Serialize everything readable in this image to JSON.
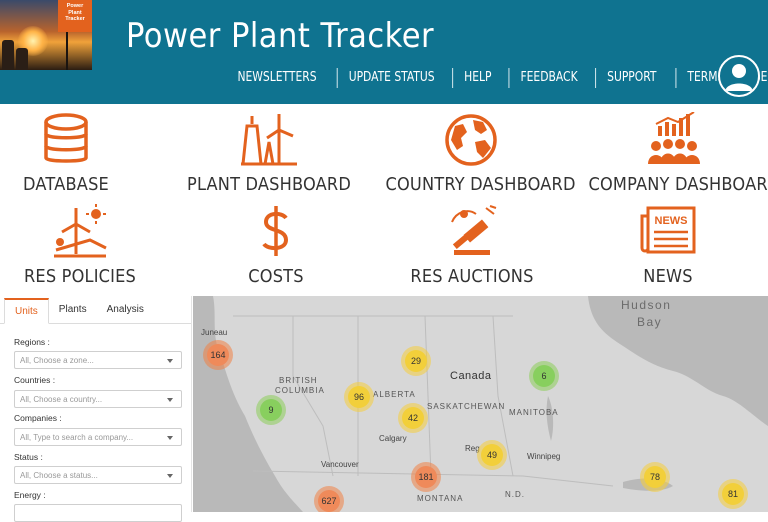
{
  "header": {
    "title": "Power Plant Tracker",
    "logo_text": [
      "Power",
      "Plant",
      "Tracker"
    ],
    "nav": [
      "NEWSLETTERS",
      "UPDATE STATUS",
      "HELP",
      "FEEDBACK",
      "SUPPORT",
      "TERMS OF USE"
    ],
    "avatar_icon": "user-icon"
  },
  "tiles": [
    {
      "label": "DATABASE",
      "icon": "database-icon"
    },
    {
      "label": "PLANT DASHBOARD",
      "icon": "power-plant-icon"
    },
    {
      "label": "COUNTRY DASHBOARD",
      "icon": "globe-icon"
    },
    {
      "label": "COMPANY DASHBOARD",
      "icon": "company-chart-icon"
    },
    {
      "label": "RES POLICIES",
      "icon": "renewable-policy-icon"
    },
    {
      "label": "COSTS",
      "icon": "dollar-icon"
    },
    {
      "label": "RES AUCTIONS",
      "icon": "auction-gavel-icon"
    },
    {
      "label": "NEWS",
      "icon": "newspaper-icon"
    }
  ],
  "tile_news_badge": "NEWS",
  "accent_color": "#e3621e",
  "header_color": "#0f7390",
  "panel": {
    "tabs": [
      "Units",
      "Plants",
      "Analysis"
    ],
    "active_tab": "Units",
    "filters": [
      {
        "label": "Regions :",
        "placeholder": "All, Choose a zone..."
      },
      {
        "label": "Countries :",
        "placeholder": "All, Choose a country..."
      },
      {
        "label": "Companies :",
        "placeholder": "All, Type to search a company..."
      },
      {
        "label": "Status :",
        "placeholder": "All, Choose a status..."
      },
      {
        "label": "Energy :",
        "placeholder": ""
      }
    ]
  },
  "map": {
    "labels": {
      "hudson": "Hudson",
      "bay": "Bay",
      "canada": "Canada",
      "british": "BRITISH",
      "columbia": "COLUMBIA",
      "alberta": "ALBERTA",
      "saskatchewan": "SASKATCHEWAN",
      "manitoba": "MANITOBA",
      "calgary": "Calgary",
      "vancouver": "Vancouver",
      "winnipeg": "Winnipeg",
      "regina": "Reg",
      "montana": "MONTANA",
      "nd": "N.D.",
      "juneau": "Juneau"
    },
    "clusters": [
      {
        "count": "164",
        "color": "orange"
      },
      {
        "count": "29",
        "color": "yellow"
      },
      {
        "count": "6",
        "color": "green"
      },
      {
        "count": "96",
        "color": "yellow"
      },
      {
        "count": "9",
        "color": "green"
      },
      {
        "count": "42",
        "color": "yellow"
      },
      {
        "count": "49",
        "color": "yellow"
      },
      {
        "count": "181",
        "color": "orange"
      },
      {
        "count": "78",
        "color": "yellow"
      },
      {
        "count": "627",
        "color": "orange"
      },
      {
        "count": "81",
        "color": "yellow"
      }
    ]
  }
}
